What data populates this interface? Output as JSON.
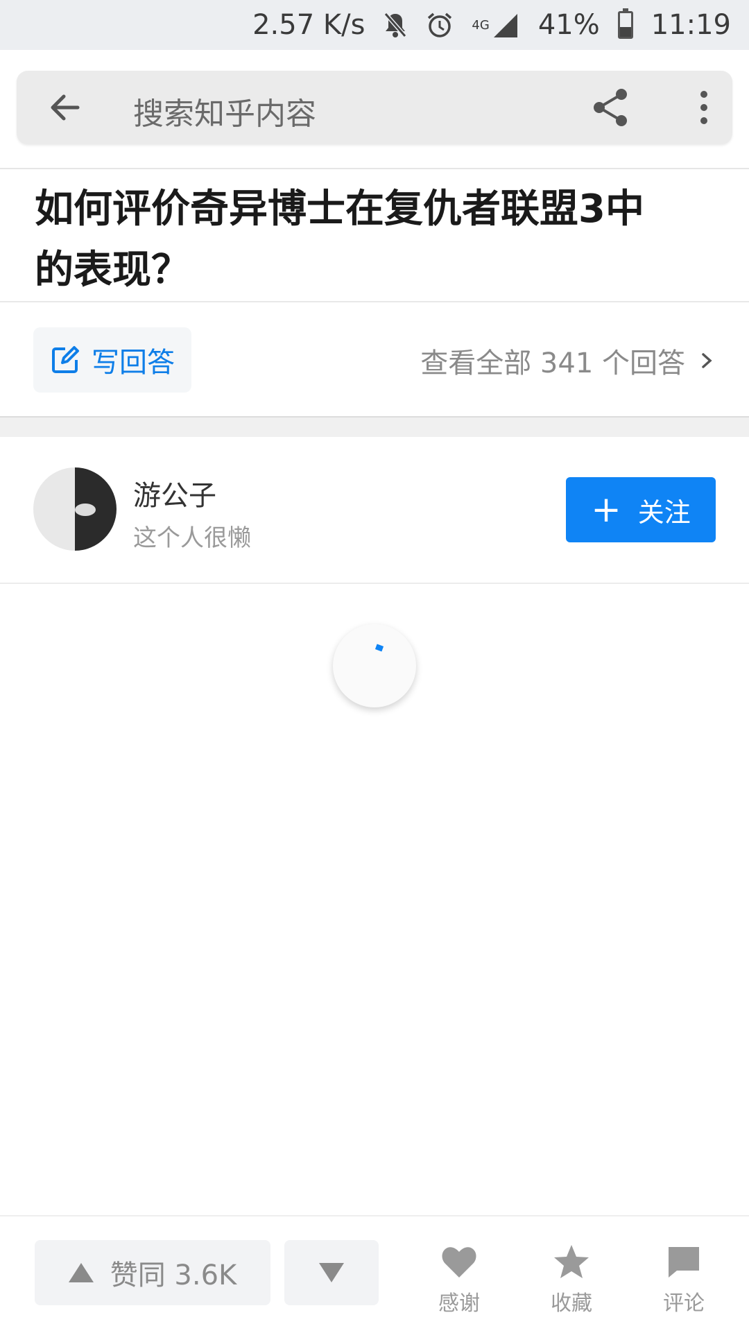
{
  "status_bar": {
    "net_speed": "2.57 K/s",
    "network": "4G",
    "battery_percent": "41%",
    "battery_level": 0.41,
    "time": "11:19",
    "icons": [
      "mute-bell-icon",
      "alarm-icon",
      "signal-icon",
      "battery-icon"
    ]
  },
  "search": {
    "placeholder": "搜索知乎内容"
  },
  "question": {
    "title": "如何评价奇异博士在复仇者联盟3中的表现？"
  },
  "answer_bar": {
    "write_label": "写回答",
    "view_all_label": "查看全部 341 个回答"
  },
  "author": {
    "name": "游公子",
    "bio": "这个人很懒",
    "follow_label": "关注"
  },
  "bottom": {
    "upvote_label": "赞同 3.6K",
    "thanks_label": "感谢",
    "collect_label": "收藏",
    "comment_label": "评论"
  },
  "colors": {
    "accent": "#0f84f5",
    "text_gray": "#8a8a8a"
  }
}
